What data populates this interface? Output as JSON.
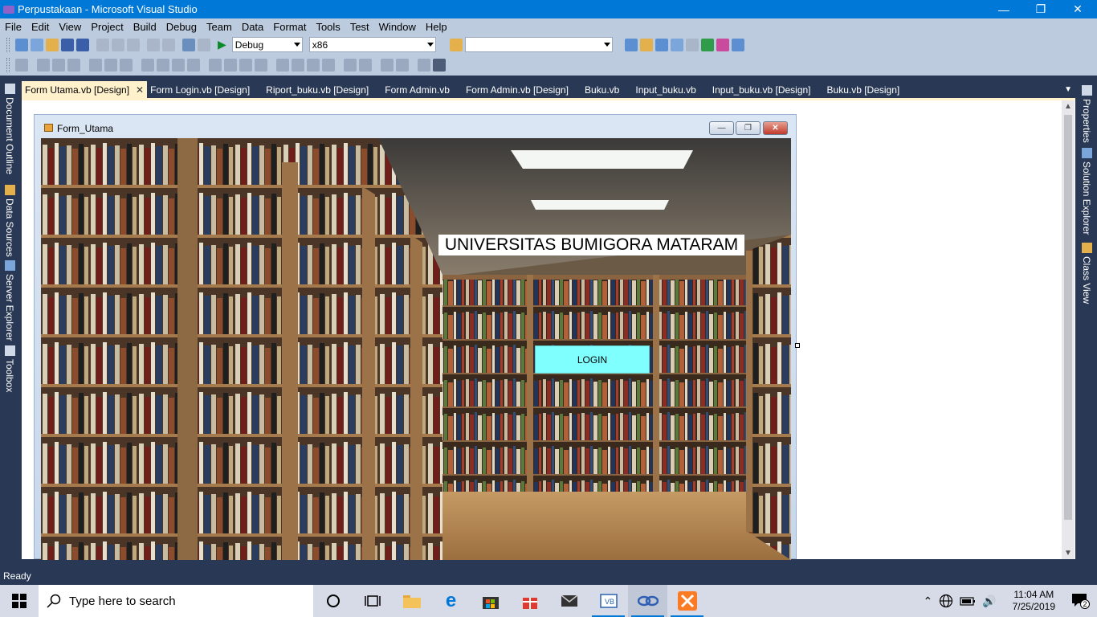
{
  "window": {
    "title": "Perpustakaan - Microsoft Visual Studio"
  },
  "menu": [
    "File",
    "Edit",
    "View",
    "Project",
    "Build",
    "Debug",
    "Team",
    "Data",
    "Format",
    "Tools",
    "Test",
    "Window",
    "Help"
  ],
  "toolbar": {
    "config_value": "Debug",
    "platform_value": "x86",
    "find_value": ""
  },
  "left_panels": [
    "Document Outline",
    "Data Sources",
    "Server Explorer",
    "Toolbox"
  ],
  "right_panels": [
    "Properties",
    "Solution Explorer",
    "Class View"
  ],
  "doc_tabs": [
    "Form Utama.vb [Design]",
    "Form Login.vb [Design]",
    "Riport_buku.vb [Design]",
    "Form Admin.vb",
    "Form Admin.vb [Design]",
    "Buku.vb",
    "Input_buku.vb",
    "Input_buku.vb [Design]",
    "Buku.vb [Design]"
  ],
  "form": {
    "title": "Form_Utama",
    "heading": "UNIVERSITAS BUMIGORA MATARAM",
    "login_label": "LOGIN"
  },
  "status": {
    "text": "Ready"
  },
  "taskbar": {
    "search_placeholder": "Type here to search",
    "time": "11:04 AM",
    "date": "7/25/2019",
    "notifications": "2"
  },
  "colors": {
    "accent": "#0078d7",
    "ide_bg": "#293955",
    "toolbar_bg": "#bccbde",
    "active_tab": "#fff1cc",
    "login_button": "#80ffff"
  }
}
